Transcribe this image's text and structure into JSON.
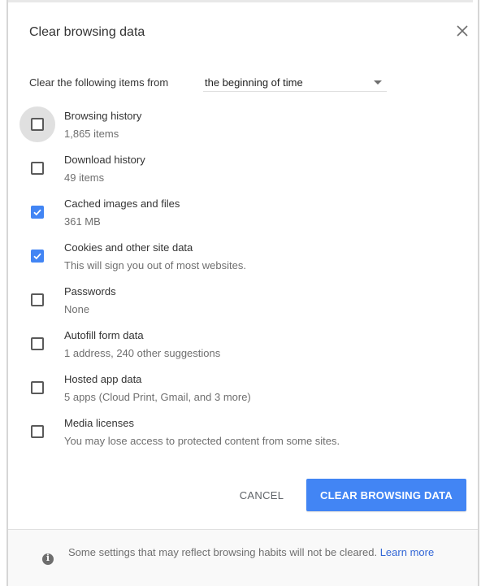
{
  "dialog": {
    "title": "Clear browsing data"
  },
  "time_range": {
    "label": "Clear the following items from",
    "selected": "the beginning of time"
  },
  "options": [
    {
      "name": "Browsing history",
      "detail": "1,865 items",
      "checked": false,
      "focused": true
    },
    {
      "name": "Download history",
      "detail": "49 items",
      "checked": false,
      "focused": false
    },
    {
      "name": "Cached images and files",
      "detail": "361 MB",
      "checked": true,
      "focused": false
    },
    {
      "name": "Cookies and other site data",
      "detail": "This will sign you out of most websites.",
      "checked": true,
      "focused": false
    },
    {
      "name": "Passwords",
      "detail": "None",
      "checked": false,
      "focused": false
    },
    {
      "name": "Autofill form data",
      "detail": "1 address, 240 other suggestions",
      "checked": false,
      "focused": false
    },
    {
      "name": "Hosted app data",
      "detail": "5 apps (Cloud Print, Gmail, and 3 more)",
      "checked": false,
      "focused": false
    },
    {
      "name": "Media licenses",
      "detail": "You may lose access to protected content from some sites.",
      "checked": false,
      "focused": false
    }
  ],
  "buttons": {
    "cancel": "CANCEL",
    "clear": "CLEAR BROWSING DATA"
  },
  "footer": {
    "text": "Some settings that may reflect browsing habits will not be cleared.",
    "link": "Learn more"
  },
  "colors": {
    "accent": "#4285f4",
    "link": "#3367d6"
  },
  "icons": {
    "close": "close-icon",
    "dropdown": "chevron-down-icon",
    "check": "checkmark-icon",
    "info": "info-icon"
  }
}
